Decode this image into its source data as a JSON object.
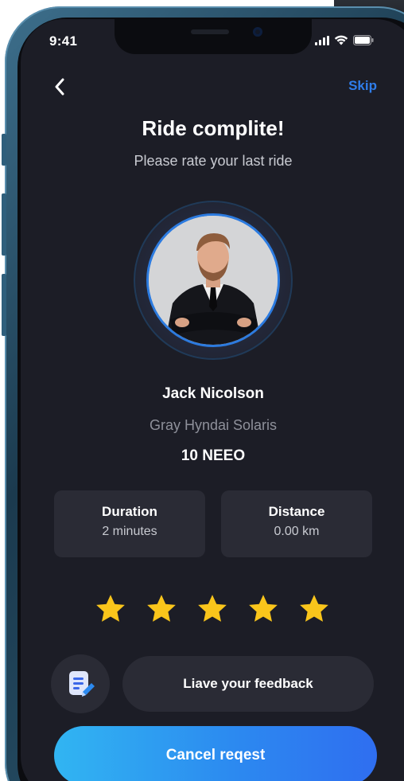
{
  "status_bar": {
    "time": "9:41",
    "icons": [
      "signal-icon",
      "wifi-icon",
      "battery-icon"
    ]
  },
  "nav": {
    "back_icon": "chevron-left-icon",
    "skip_label": "Skip"
  },
  "header": {
    "title": "Ride complite!",
    "subtitle": "Please rate your last ride"
  },
  "driver": {
    "name": "Jack Nicolson",
    "car": "Gray Hyndai Solaris",
    "plate": "10 NEEO"
  },
  "trip_stats": [
    {
      "label": "Duration",
      "value": "2 minutes"
    },
    {
      "label": "Distance",
      "value": "0.00 km"
    }
  ],
  "rating": {
    "stars_filled": 5,
    "stars_total": 5,
    "star_color": "#f9c51b"
  },
  "feedback": {
    "icon": "note-edit-icon",
    "label": "Liave your feedback"
  },
  "actions": {
    "cancel_label": "Cancel reqest"
  },
  "colors": {
    "accent": "#2f7dea",
    "background": "#1c1d26",
    "card": "#2a2b35"
  }
}
